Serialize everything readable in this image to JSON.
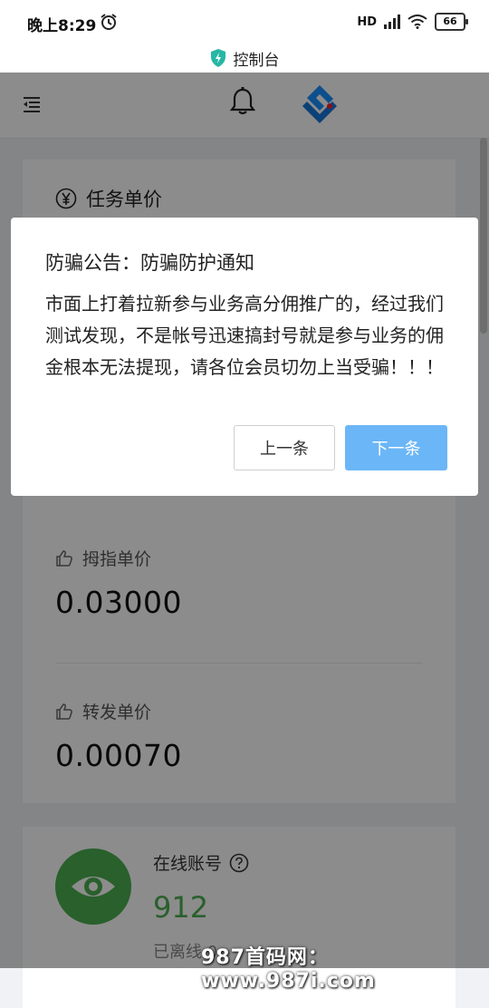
{
  "status_bar": {
    "time": "晚上8:29",
    "signal": "HD",
    "battery": "66"
  },
  "title_bar": {
    "title": "控制台"
  },
  "header": {
    "menu_icon": "menu-fold-icon",
    "bell_icon": "bell-icon",
    "logo_icon": "ant-design-logo"
  },
  "task_card": {
    "title": "任务单价",
    "items": [
      {
        "label": "拇指单价",
        "value": "0.03000"
      },
      {
        "label": "转发单价",
        "value": "0.00070"
      }
    ]
  },
  "online_card": {
    "label": "在线账号",
    "value": "912",
    "offline_label": "已离线 0"
  },
  "modal": {
    "title": "防骗公告：防骗防护通知",
    "body": "市面上打着拉新参与业务高分佣推广的，经过我们测试发现，不是帐号迅速搞封号就是参与业务的佣金根本无法提现，请各位会员切勿上当受骗！！！",
    "prev_button": "上一条",
    "next_button": "下一条"
  },
  "watermark": "987首码网：www.987i.com",
  "colors": {
    "accent_blue": "#6bb6f7",
    "online_green": "#4caf50",
    "overlay": "rgba(0,0,0,0.45)"
  }
}
